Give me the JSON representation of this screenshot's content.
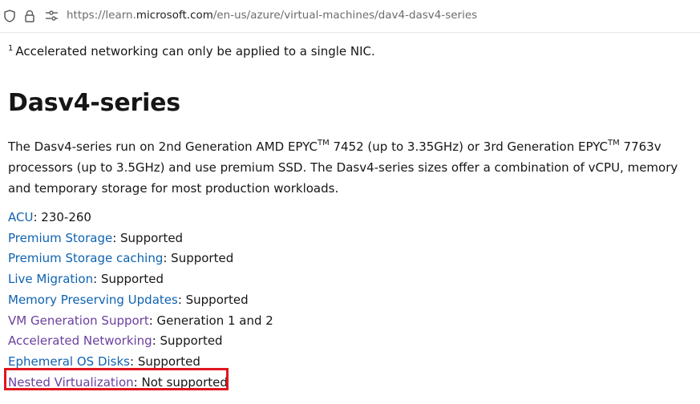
{
  "browser": {
    "url_prefix": "https://learn.",
    "url_host": "microsoft.com",
    "url_path": "/en-us/azure/virtual-machines/dav4-dasv4-series",
    "icons": [
      "shield-icon",
      "lock-icon",
      "page-settings-icon"
    ]
  },
  "footnote": {
    "marker": "1",
    "text": "Accelerated networking can only be applied to a single NIC."
  },
  "heading": "Dasv4-series",
  "description": {
    "part1": "The Dasv4-series run on 2nd Generation AMD EPYC",
    "tm1": "TM",
    "part2": " 7452 (up to 3.35GHz) or 3rd Generation EPYC",
    "tm2": "TM",
    "part3": " 7763v processors (up to 3.5GHz) and use premium SSD. The Dasv4-series sizes offer a combination of vCPU, memory and temporary storage for most production workloads."
  },
  "properties": [
    {
      "link": "ACU",
      "value": ": 230-260",
      "visited": false
    },
    {
      "link": "Premium Storage",
      "value": ": Supported",
      "visited": false
    },
    {
      "link": "Premium Storage caching",
      "value": ": Supported",
      "visited": false
    },
    {
      "link": "Live Migration",
      "value": ": Supported",
      "visited": false
    },
    {
      "link": "Memory Preserving Updates",
      "value": ": Supported",
      "visited": false
    },
    {
      "link": "VM Generation Support",
      "value": ": Generation 1 and 2",
      "visited": true
    },
    {
      "link": "Accelerated Networking",
      "value": ": Supported",
      "visited": true
    },
    {
      "link": "Ephemeral OS Disks",
      "value": ": Supported",
      "visited": false
    },
    {
      "link": "Nested Virtualization",
      "value": ": Not supported",
      "visited": true
    }
  ],
  "colors": {
    "link": "#0f63b0",
    "visited_link": "#6a3fa0",
    "highlight_box": "#e0161e"
  }
}
